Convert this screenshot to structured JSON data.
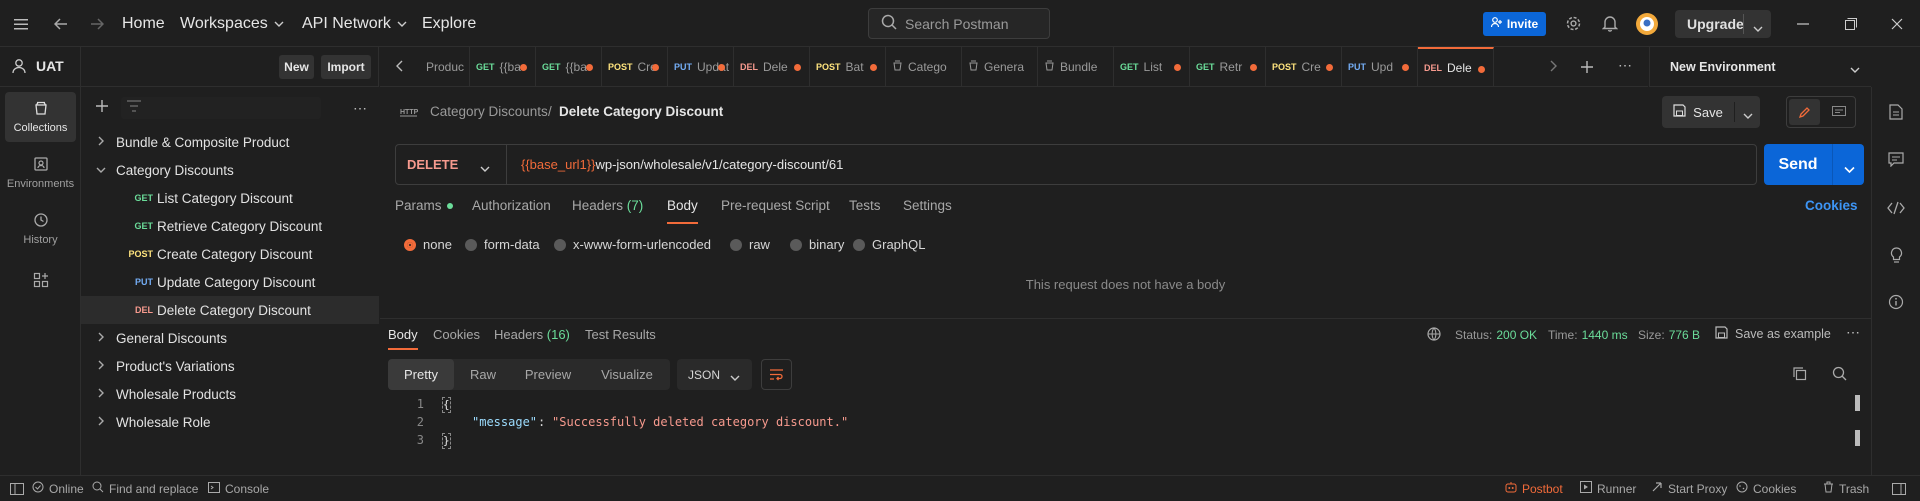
{
  "topbar": {
    "home": "Home",
    "workspaces": "Workspaces",
    "api_network": "API Network",
    "explore": "Explore",
    "search_placeholder": "Search Postman",
    "invite": "Invite",
    "upgrade": "Upgrade"
  },
  "workspace": {
    "name": "UAT",
    "new_label": "New",
    "import_label": "Import"
  },
  "rail": {
    "collections": "Collections",
    "environments": "Environments",
    "history": "History"
  },
  "tree": [
    {
      "label": "Bundle & Composite Product",
      "expanded": false
    },
    {
      "label": "Category Discounts",
      "expanded": true
    },
    {
      "method": "GET",
      "label": "List Category Discount"
    },
    {
      "method": "GET",
      "label": "Retrieve Category Discount"
    },
    {
      "method": "POST",
      "label": "Create Category Discount"
    },
    {
      "method": "PUT",
      "label": "Update Category Discount"
    },
    {
      "method": "DEL",
      "label": "Delete Category Discount"
    },
    {
      "label": "General Discounts",
      "expanded": false
    },
    {
      "label": "Product's Variations",
      "expanded": false
    },
    {
      "label": "Wholesale Products",
      "expanded": false
    },
    {
      "label": "Wholesale Role",
      "expanded": false
    }
  ],
  "tabs": [
    {
      "method": "",
      "label": "Produc"
    },
    {
      "method": "GET",
      "label": "{{ba"
    },
    {
      "method": "GET",
      "label": "{{ba"
    },
    {
      "method": "POST",
      "label": "Cre"
    },
    {
      "method": "PUT",
      "label": "Updat"
    },
    {
      "method": "DEL",
      "label": "Dele"
    },
    {
      "method": "POST",
      "label": "Bat"
    },
    {
      "method": "",
      "label": "Catego"
    },
    {
      "method": "",
      "label": "Genera"
    },
    {
      "method": "",
      "label": "Bundle"
    },
    {
      "method": "GET",
      "label": "List"
    },
    {
      "method": "GET",
      "label": "Retr"
    },
    {
      "method": "POST",
      "label": "Cre"
    },
    {
      "method": "PUT",
      "label": "Upd"
    },
    {
      "method": "DEL",
      "label": "Dele"
    }
  ],
  "environment": "New Environment",
  "request": {
    "breadcrumb_parent": "Category Discounts",
    "breadcrumb_sep": "/",
    "title": "Delete Category Discount",
    "save": "Save",
    "method": "DELETE",
    "url_var": "{{base_url1}}",
    "url_path": "wp-json/wholesale/v1/category-discount/61",
    "send": "Send",
    "tabs": {
      "params": "Params",
      "authorization": "Authorization",
      "headers": "Headers",
      "headers_count": "(7)",
      "body": "Body",
      "prerequest": "Pre-request Script",
      "tests": "Tests",
      "settings": "Settings",
      "cookies": "Cookies"
    },
    "body_types": [
      "none",
      "form-data",
      "x-www-form-urlencoded",
      "raw",
      "binary",
      "GraphQL"
    ],
    "no_body": "This request does not have a body"
  },
  "response": {
    "tabs": {
      "body": "Body",
      "cookies": "Cookies",
      "headers": "Headers",
      "headers_count": "(16)",
      "test_results": "Test Results"
    },
    "status_label": "Status:",
    "status_value": "200 OK",
    "time_label": "Time:",
    "time_value": "1440 ms",
    "size_label": "Size:",
    "size_value": "776 B",
    "save_example": "Save as example",
    "views": [
      "Pretty",
      "Raw",
      "Preview",
      "Visualize"
    ],
    "format": "JSON",
    "lines": [
      "1",
      "2",
      "3"
    ],
    "code_open": "{",
    "code_key": "\"message\"",
    "code_colon": ": ",
    "code_value": "\"Successfully deleted category discount.\"",
    "code_close": "}"
  },
  "statusbar": {
    "online": "Online",
    "find_replace": "Find and replace",
    "console": "Console",
    "postbot": "Postbot",
    "runner": "Runner",
    "start_proxy": "Start Proxy",
    "cookies": "Cookies",
    "trash": "Trash"
  },
  "colors": {
    "accent": "#f26b3a",
    "primary": "#0b66d8",
    "get": "#6bdd9a",
    "post": "#ffe47e",
    "put": "#74aef6",
    "del": "#f79a8e",
    "ok": "#6bdd9a"
  }
}
